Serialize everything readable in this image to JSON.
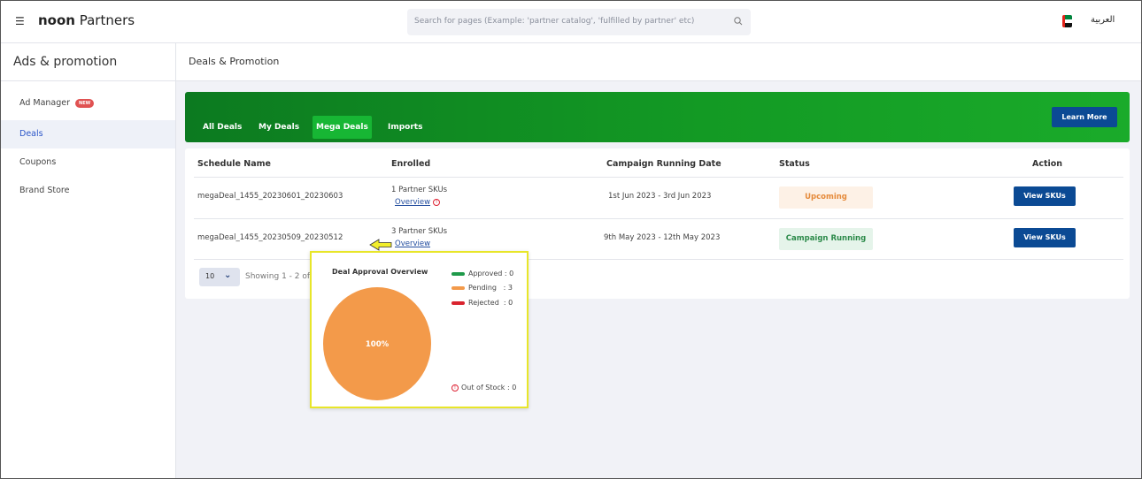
{
  "header": {
    "brand_bold": "noon",
    "brand_rest": " Partners",
    "search_placeholder": "Search for pages (Example: 'partner catalog', 'fulfilled by partner' etc)",
    "language": "العربية"
  },
  "sidebar": {
    "title": "Ads & promotion",
    "items": [
      {
        "label": "Ad Manager",
        "badge": "NEW"
      },
      {
        "label": "Deals"
      },
      {
        "label": "Coupons"
      },
      {
        "label": "Brand Store"
      }
    ]
  },
  "main": {
    "title": "Deals & Promotion",
    "tabs": [
      "All Deals",
      "My Deals",
      "Mega Deals",
      "Imports"
    ],
    "active_tab": "Mega Deals",
    "learn_more": "Learn More",
    "table": {
      "headers": [
        "Schedule Name",
        "Enrolled",
        "Campaign Running Date",
        "Status",
        "Action"
      ],
      "rows": [
        {
          "name": "megaDeal_1455_20230601_20230603",
          "enrolled": "1 Partner SKUs",
          "overview": "Overview",
          "date": "1st Jun 2023 - 3rd Jun 2023",
          "status": "Upcoming",
          "action": "View SKUs"
        },
        {
          "name": "megaDeal_1455_20230509_20230512",
          "enrolled": "3 Partner SKUs",
          "overview": "Overview",
          "date": "9th May 2023 - 12th May 2023",
          "status": "Campaign Running",
          "action": "View SKUs"
        }
      ]
    },
    "pagination": {
      "per_page": "10",
      "showing": "Showing 1 - 2 of"
    }
  },
  "popup": {
    "title": "Deal Approval Overview",
    "pie_label": "100%",
    "legend": [
      {
        "label": "Approved",
        "value": "0",
        "color": "#1f9a4a"
      },
      {
        "label": "Pending",
        "value": "3",
        "color": "#f39a4a"
      },
      {
        "label": "Rejected",
        "value": "0",
        "color": "#d9232e"
      }
    ],
    "out_of_stock": "Out of Stock : 0"
  },
  "colors": {
    "accent_green": "#139a24",
    "primary_blue": "#0b4a94",
    "pie_fill": "#f39a4a",
    "highlight": "#e8e629"
  }
}
